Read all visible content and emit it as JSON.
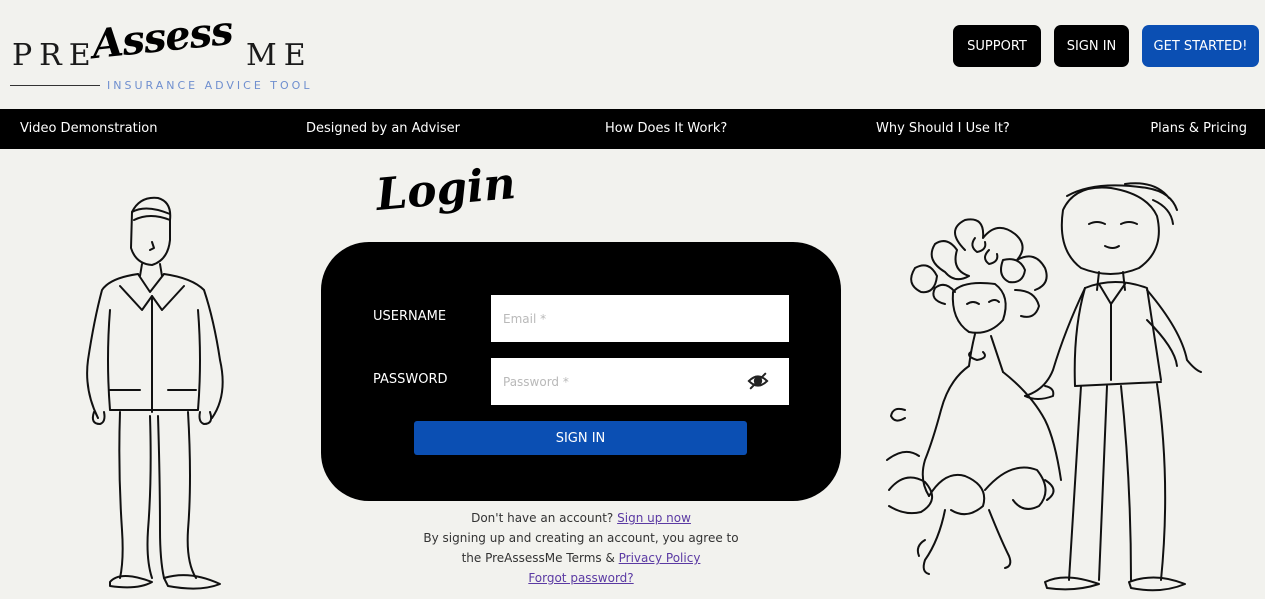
{
  "header": {
    "logo": {
      "pre": "PRE",
      "assess": "Assess",
      "me": "ME",
      "tagline": "INSURANCE ADVICE TOOL"
    },
    "buttons": {
      "support": "SUPPORT",
      "sign_in": "SIGN IN",
      "get_started": "GET STARTED!"
    }
  },
  "nav": {
    "items": [
      {
        "label": "Video Demonstration"
      },
      {
        "label": "Designed by an Adviser"
      },
      {
        "label": "How Does It Work?"
      },
      {
        "label": "Why Should I Use It?"
      },
      {
        "label": "Plans & Pricing"
      }
    ]
  },
  "login": {
    "title": "Login",
    "username_label": "USERNAME",
    "username_placeholder": "Email *",
    "password_label": "PASSWORD",
    "password_placeholder": "Password *",
    "submit_label": "SIGN IN"
  },
  "footer": {
    "no_account": "Don't have an account?",
    "sign_up_link": "Sign up now",
    "agree_line1": "By signing up and creating an account, you agree to",
    "agree_line2": "the PreAssessMe Terms &",
    "privacy_link": "Privacy Policy",
    "forgot_link": "Forgot password?"
  },
  "colors": {
    "accent": "#0b4fb3",
    "background": "#f2f2ee",
    "card": "#000000",
    "link": "#5b3aa3"
  },
  "icons": {
    "password_toggle": "eye-off-icon"
  }
}
